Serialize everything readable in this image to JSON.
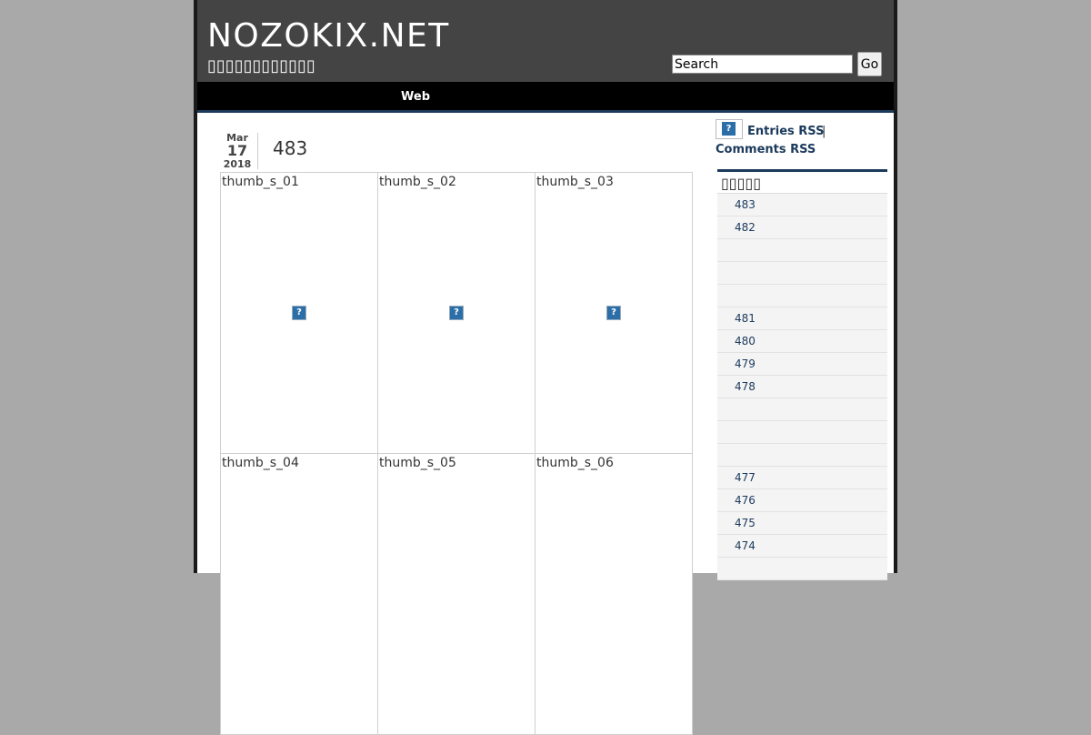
{
  "site": {
    "title": "NOZOKIX.NET",
    "description": "▯▯▯▯▯▯▯▯▯▯▯▯"
  },
  "search": {
    "value": "Search",
    "go_label": "Go"
  },
  "nav": {
    "items": [
      {
        "label": "Web"
      }
    ]
  },
  "post": {
    "date": {
      "month": "Mar",
      "day": "17",
      "year": "2018"
    },
    "title": "483",
    "thumbs": [
      {
        "label": "thumb_s_01"
      },
      {
        "label": "thumb_s_02"
      },
      {
        "label": "thumb_s_03"
      },
      {
        "label": "thumb_s_04"
      },
      {
        "label": "thumb_s_05"
      },
      {
        "label": "thumb_s_06"
      }
    ],
    "broken_image_glyph": "?"
  },
  "sidebar": {
    "rss_icon_glyph": "?",
    "entries_rss": "Entries RSS",
    "separator": "|",
    "comments_rss": "Comments RSS",
    "widget_title": "▯▯▯▯▯",
    "items": [
      {
        "label": "483"
      },
      {
        "label": "482"
      },
      {
        "label": ""
      },
      {
        "label": ""
      },
      {
        "label": ""
      },
      {
        "label": "481"
      },
      {
        "label": "480"
      },
      {
        "label": "479"
      },
      {
        "label": "478"
      },
      {
        "label": ""
      },
      {
        "label": ""
      },
      {
        "label": ""
      },
      {
        "label": "477"
      },
      {
        "label": "476"
      },
      {
        "label": "475"
      },
      {
        "label": "474"
      },
      {
        "label": ""
      }
    ]
  },
  "colors": {
    "background": "#a9a9a9",
    "header": "#444444",
    "nav": "#000000",
    "accent": "#1b3a5c"
  }
}
